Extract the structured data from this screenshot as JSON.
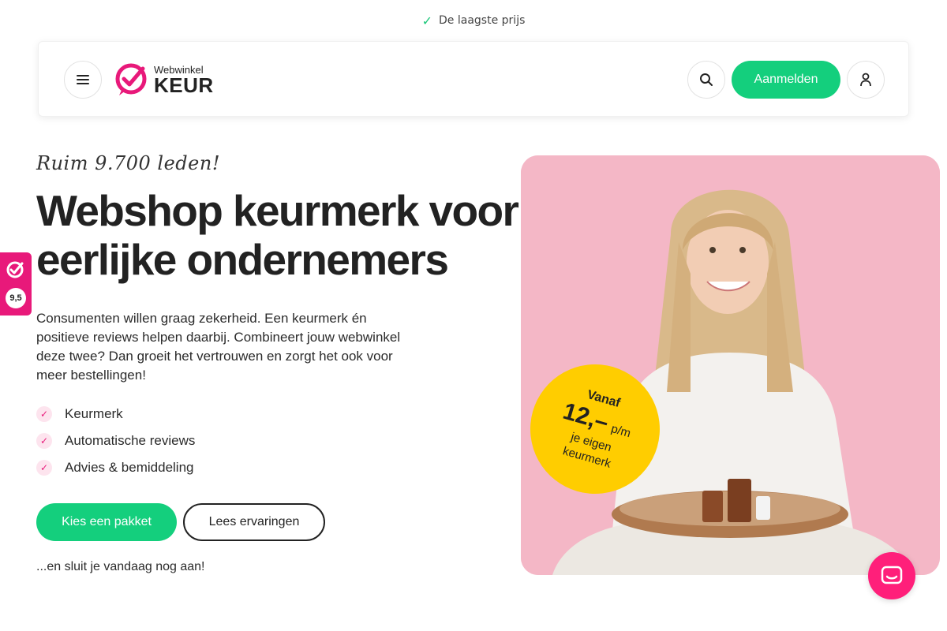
{
  "topbar": {
    "text": "De laagste prijs",
    "icon": "check-icon"
  },
  "header": {
    "logo": {
      "small": "Webwinkel",
      "big": "KEUR"
    },
    "login_label": "Aanmelden"
  },
  "hero": {
    "tagline": "Ruim 9.700 leden!",
    "headline_line1": "Webshop keurmerk voor",
    "headline_line2": "eerlijke ondernemers",
    "description": "Consumenten willen graag zekerheid. Een keurmerk én positieve reviews helpen daarbij. Combineert jouw webwinkel deze twee? Dan groeit het vertrouwen en zorgt het ook voor meer bestellingen!",
    "features": [
      "Keurmerk",
      "Automatische reviews",
      "Advies & bemiddeling"
    ],
    "cta_primary": "Kies een pakket",
    "cta_secondary": "Lees ervaringen",
    "note": "...en sluit je vandaag nog aan!"
  },
  "rating_badge": {
    "score": "9,5"
  },
  "price_badge": {
    "from": "Vanaf",
    "amount": "12,–",
    "unit": "p/m",
    "sub_line1": "je eigen",
    "sub_line2": "keurmerk"
  },
  "colors": {
    "brand_pink": "#e8197a",
    "cta_green": "#14cf7d",
    "badge_yellow": "#ffcd00",
    "hero_bg": "#f4b7c6"
  }
}
